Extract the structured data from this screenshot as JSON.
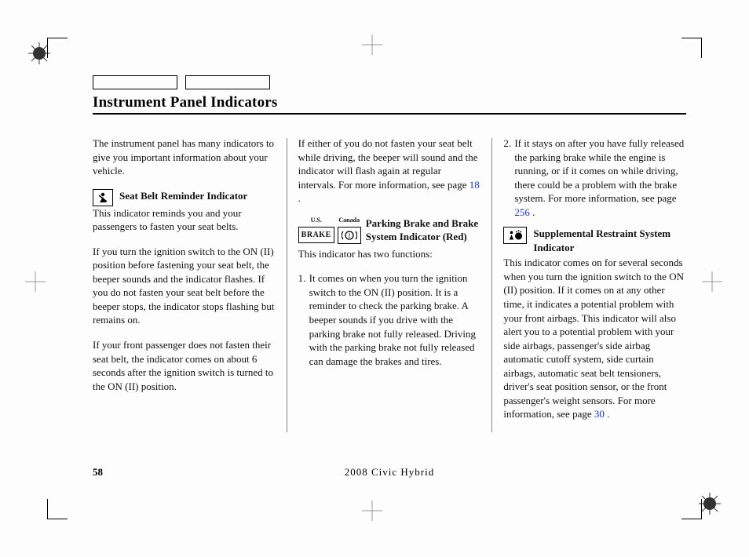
{
  "page": {
    "title": "Instrument Panel Indicators",
    "number": "58",
    "model": "2008  Civic  Hybrid"
  },
  "col1": {
    "intro": "The instrument panel has many indicators to give you important information about your vehicle.",
    "seatbelt": {
      "heading": "Seat Belt Reminder Indicator",
      "p1": "This indicator reminds you and your passengers to fasten your seat belts.",
      "p2": "If you turn the ignition switch to the ON (II) position before fastening your seat belt, the beeper sounds and the indicator flashes. If you do not fasten your seat belt before the beeper stops, the indicator stops flashing but remains on.",
      "p3": "If your front passenger does not fasten their seat belt, the indicator comes on about 6 seconds after the ignition switch is turned to the ON (II) position."
    }
  },
  "col2": {
    "p1a": "If either of you do not fasten your seat belt while driving, the beeper will sound and the indicator will flash again at regular intervals. For more information, see page ",
    "p1link": "18",
    "p1b": " .",
    "brake": {
      "us_label": "U.S.",
      "ca_label": "Canada",
      "us_box": "BRAKE",
      "heading": "Parking Brake and Brake System Indicator (Red)",
      "p1": "This indicator has two functions:",
      "li1": "It comes on when you turn the ignition switch to the ON (II) position. It is a reminder to check the parking brake. A beeper sounds if you drive with the parking brake not fully released. Driving with the parking brake not fully released can damage the brakes and tires."
    }
  },
  "col3": {
    "li2a": "If it stays on after you have fully released the parking brake while the engine is running, or if it comes on while driving, there could be a problem with the brake system. For more information, see page ",
    "li2link": "256",
    "li2b": " .",
    "srs": {
      "heading": "Supplemental Restraint System Indicator",
      "p1a": "This indicator comes on for several seconds when you turn the ignition switch to the ON (II) position. If it comes on at any other time, it indicates a potential problem with your front airbags. This indicator will also alert you to a potential problem with your side airbags, passenger's side airbag automatic cutoff system, side curtain airbags, automatic seat belt tensioners, driver's seat position sensor, or the front passenger's weight sensors. For more information, see page ",
      "p1link": "30",
      "p1b": " ."
    }
  },
  "list": {
    "n1": "1.",
    "n2": "2."
  }
}
